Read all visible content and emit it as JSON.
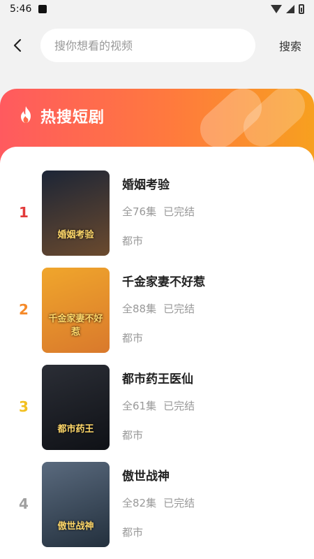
{
  "status_bar": {
    "time": "5:46"
  },
  "search": {
    "placeholder": "搜你想看的视频",
    "value": "",
    "button_label": "搜索"
  },
  "banner": {
    "title": "热搜短剧"
  },
  "dramas": [
    {
      "rank": "1",
      "rank_color": "#e23b3b",
      "title": "婚姻考验",
      "episodes": "全76集",
      "status": "已完结",
      "genre": "都市",
      "poster_text": "婚姻考验",
      "poster_bg": [
        "#1c2536",
        "#6b4a2e"
      ]
    },
    {
      "rank": "2",
      "rank_color": "#f58a2a",
      "title": "千金家妻不好惹",
      "episodes": "全88集",
      "status": "已完结",
      "genre": "都市",
      "poster_text": "千金家妻不好惹",
      "poster_bg": [
        "#f0a62c",
        "#d9792c"
      ]
    },
    {
      "rank": "3",
      "rank_color": "#f2c020",
      "title": "都市药王医仙",
      "episodes": "全61集",
      "status": "已完结",
      "genre": "都市",
      "poster_text": "都市药王",
      "poster_bg": [
        "#2b2e36",
        "#0f1116"
      ]
    },
    {
      "rank": "4",
      "rank_color": "#a0a0a0",
      "title": "傲世战神",
      "episodes": "全82集",
      "status": "已完结",
      "genre": "都市",
      "poster_text": "傲世战神",
      "poster_bg": [
        "#5a6a7e",
        "#23303d"
      ]
    }
  ]
}
